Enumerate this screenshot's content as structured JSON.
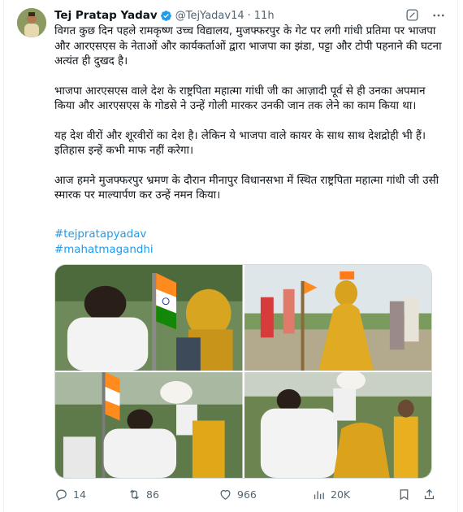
{
  "tweet": {
    "author_name": "Tej Pratap Yadav",
    "handle": "@TejYadav14",
    "separator": "·",
    "time": "11h",
    "paragraphs": [
      "विगत कुछ दिन पहले रामकृष्ण उच्च विद्यालय, मुजफ्फरपुर के गेट पर लगी गांधी प्रतिमा पर भाजपा और आरएसएस के नेताओं और कार्यकर्ताओं द्वारा भाजपा का झंडा, पट्टा और टोपी पहनाने की घटना अत्यंत ही दुखद है।",
      "भाजपा आरएसएस वाले देश के राष्ट्रपिता महात्मा गांधी जी का आज़ादी पूर्व से ही उनका अपमान किया और आरएसएस के गोडसे ने उन्हें गोली मारकर उनकी जान तक लेने का काम किया था।",
      "यह देश वीरों और शूरवीरों का देश है। लेकिन ये भाजपा वाले कायर के साथ साथ देशद्रोही भी हैं। इतिहास इन्हें कभी माफ नहीं करेगा।",
      "आज हमने मुजफ्फरपुर भ्रमण के दौरान मीनापुर विधानसभा में स्थित राष्ट्रपिता महात्मा गांधी जी उसी स्मारक पर माल्यार्पण कर उन्हें नमन किया।"
    ],
    "hashtags": [
      "#tejpratapyadav",
      "#mahatmagandhi"
    ]
  },
  "icons": {
    "verified": "verified-badge-icon",
    "grok": "grok-icon",
    "more": "more-options-icon",
    "reply": "reply-icon",
    "retweet": "retweet-icon",
    "like": "heart-icon",
    "views": "views-icon",
    "bookmark": "bookmark-icon",
    "share": "share-icon"
  },
  "actions": {
    "replies": "14",
    "retweets": "86",
    "likes": "966",
    "views": "20K"
  },
  "colors": {
    "link": "#1d9bf0",
    "muted": "#536471",
    "text": "#0f1419",
    "verified": "#1d9bf0"
  }
}
